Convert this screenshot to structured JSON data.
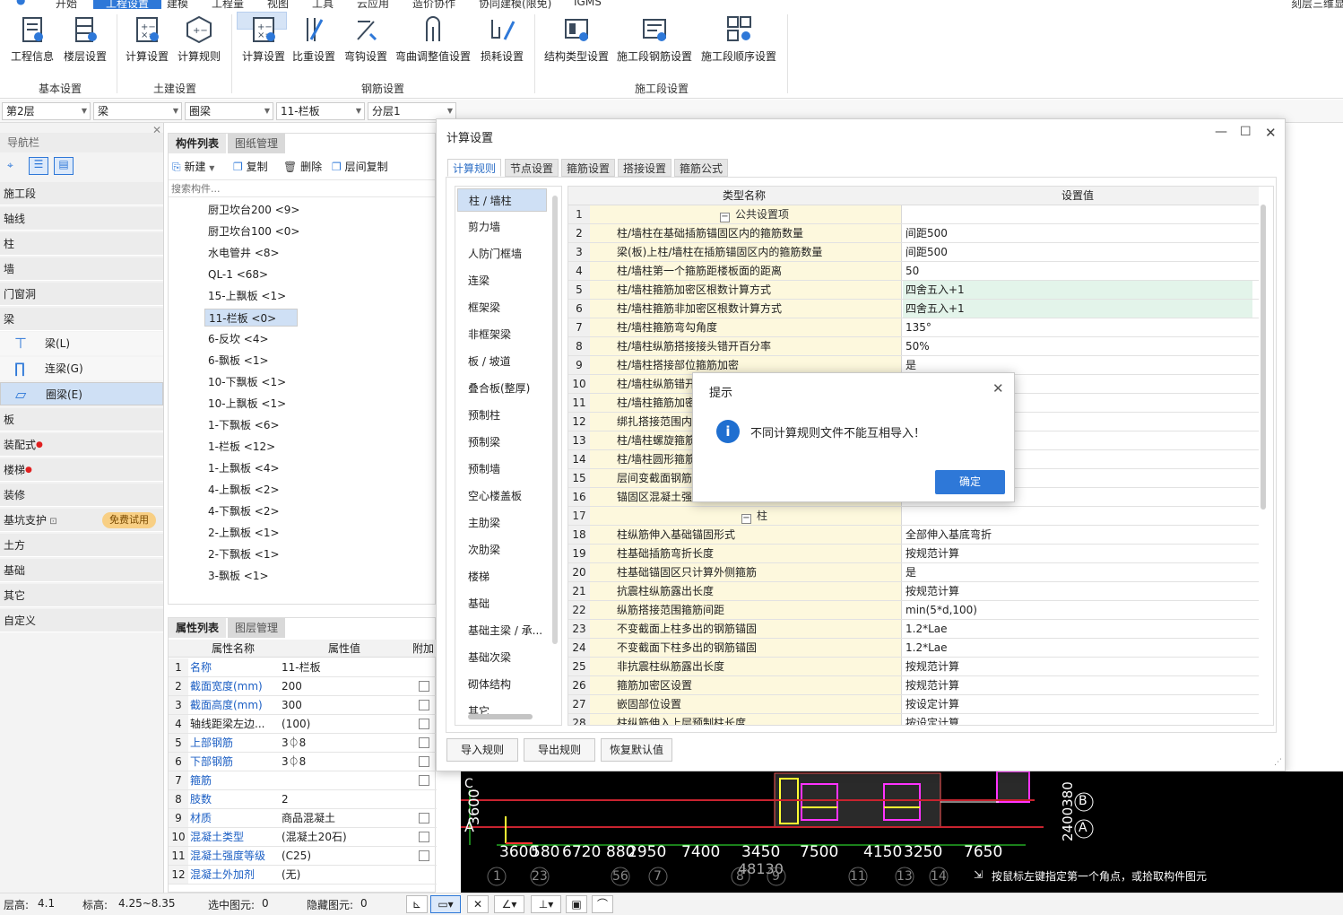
{
  "menu": {
    "items": [
      "开始",
      "工程设置",
      "建模",
      "工程量",
      "视图",
      "工具",
      "云应用",
      "造价协作",
      "协同建模(限免)",
      "IGMS"
    ],
    "active": "工程设置",
    "right_text": "刻层三维显"
  },
  "ribbon": {
    "buttons": [
      "工程信息",
      "楼层设置",
      "计算设置",
      "计算规则",
      "计算设置",
      "比重设置",
      "弯钩设置",
      "弯曲调整值设置",
      "损耗设置",
      "结构类型设置",
      "施工段钢筋设置",
      "施工段顺序设置"
    ],
    "groups": [
      "基本设置",
      "土建设置",
      "钢筋设置",
      "施工段设置"
    ]
  },
  "selectors": [
    "第2层",
    "梁",
    "圈梁",
    "11-栏板",
    "分层1"
  ],
  "nav": {
    "title": "导航栏",
    "items": [
      "施工段",
      "轴线",
      "柱",
      "墙",
      "门窗洞",
      "梁",
      "板",
      "装配式",
      "楼梯",
      "装修",
      "基坑支护",
      "土方",
      "基础",
      "其它",
      "自定义"
    ],
    "sub_items": [
      "梁(L)",
      "连梁(G)",
      "圈梁(E)"
    ],
    "trial_badge": "免费试用"
  },
  "components": {
    "tabs": [
      "构件列表",
      "图纸管理"
    ],
    "toolbar": [
      "新建",
      "复制",
      "删除",
      "层间复制"
    ],
    "search_placeholder": "搜索构件...",
    "items": [
      "厨卫坎台200 <9>",
      "厨卫坎台100 <0>",
      "水电管井 <8>",
      "QL-1 <68>",
      "15-上飘板 <1>",
      "11-栏板 <0>",
      "6-反坎 <4>",
      "6-飘板 <1>",
      "10-下飘板 <1>",
      "10-上飘板 <1>",
      "1-下飘板 <6>",
      "1-栏板 <12>",
      "1-上飘板 <4>",
      "4-上飘板 <2>",
      "4-下飘板 <2>",
      "2-上飘板 <1>",
      "2-下飘板 <1>",
      "3-飘板 <1>"
    ],
    "selected": "11-栏板 <0>"
  },
  "properties": {
    "tabs": [
      "属性列表",
      "图层管理"
    ],
    "headers": [
      "属性名称",
      "属性值",
      "附加"
    ],
    "rows": [
      {
        "no": "1",
        "name": "名称",
        "value": "11-栏板"
      },
      {
        "no": "2",
        "name": "截面宽度(mm)",
        "value": "200"
      },
      {
        "no": "3",
        "name": "截面高度(mm)",
        "value": "300"
      },
      {
        "no": "4",
        "name": "轴线距梁左边...",
        "value": "(100)"
      },
      {
        "no": "5",
        "name": "上部钢筋",
        "value": "3⏀8"
      },
      {
        "no": "6",
        "name": "下部钢筋",
        "value": "3⏀8"
      },
      {
        "no": "7",
        "name": "箍筋",
        "value": ""
      },
      {
        "no": "8",
        "name": "肢数",
        "value": "2"
      },
      {
        "no": "9",
        "name": "材质",
        "value": "商品混凝土"
      },
      {
        "no": "10",
        "name": "混凝土类型",
        "value": "(混凝土20石)"
      },
      {
        "no": "11",
        "name": "混凝土强度等级",
        "value": "(C25)"
      },
      {
        "no": "12",
        "name": "混凝土外加剂",
        "value": "(无)"
      }
    ]
  },
  "dialog": {
    "title": "计算设置",
    "tabs": [
      "计算规则",
      "节点设置",
      "箍筋设置",
      "搭接设置",
      "箍筋公式"
    ],
    "categories": [
      "柱 / 墙柱",
      "剪力墙",
      "人防门框墙",
      "连梁",
      "框架梁",
      "非框架梁",
      "板 / 坡道",
      "叠合板(整厚)",
      "预制柱",
      "预制梁",
      "预制墙",
      "空心楼盖板",
      "主肋梁",
      "次肋梁",
      "楼梯",
      "基础",
      "基础主梁 / 承...",
      "基础次梁",
      "砌体结构",
      "其它"
    ],
    "headers": [
      "类型名称",
      "设置值"
    ],
    "rows": [
      {
        "no": "1",
        "name": "公共设置项",
        "value": "",
        "group": true
      },
      {
        "no": "2",
        "name": "柱/墙柱在基础插筋锚固区内的箍筋数量",
        "value": "间距500"
      },
      {
        "no": "3",
        "name": "梁(板)上柱/墙柱在插筋锚固区内的箍筋数量",
        "value": "间距500"
      },
      {
        "no": "4",
        "name": "柱/墙柱第一个箍筋距楼板面的距离",
        "value": "50"
      },
      {
        "no": "5",
        "name": "柱/墙柱箍筋加密区根数计算方式",
        "value": "四舍五入+1",
        "hl": true
      },
      {
        "no": "6",
        "name": "柱/墙柱箍筋非加密区根数计算方式",
        "value": "四舍五入+1",
        "hl": true
      },
      {
        "no": "7",
        "name": "柱/墙柱箍筋弯勾角度",
        "value": "135°"
      },
      {
        "no": "8",
        "name": "柱/墙柱纵筋搭接接头错开百分率",
        "value": "50%"
      },
      {
        "no": "9",
        "name": "柱/墙柱搭接部位箍筋加密",
        "value": "是"
      },
      {
        "no": "10",
        "name": "柱/墙柱纵筋错开",
        "value": ""
      },
      {
        "no": "11",
        "name": "柱/墙柱箍筋加密",
        "value": ""
      },
      {
        "no": "12",
        "name": "绑扎搭接范围内",
        "value": ""
      },
      {
        "no": "13",
        "name": "柱/墙柱螺旋箍筋",
        "value": ""
      },
      {
        "no": "14",
        "name": "柱/墙柱圆形箍筋",
        "value": ""
      },
      {
        "no": "15",
        "name": "层间变截面钢筋",
        "value": ""
      },
      {
        "no": "16",
        "name": "锚固区混凝土强",
        "value": ""
      },
      {
        "no": "17",
        "name": "柱",
        "value": "",
        "group": true
      },
      {
        "no": "18",
        "name": "柱纵筋伸入基础锚固形式",
        "value": "全部伸入基底弯折"
      },
      {
        "no": "19",
        "name": "柱基础插筋弯折长度",
        "value": "按规范计算"
      },
      {
        "no": "20",
        "name": "柱基础锚固区只计算外侧箍筋",
        "value": "是"
      },
      {
        "no": "21",
        "name": "抗震柱纵筋露出长度",
        "value": "按规范计算"
      },
      {
        "no": "22",
        "name": "纵筋搭接范围箍筋间距",
        "value": "min(5*d,100)"
      },
      {
        "no": "23",
        "name": "不变截面上柱多出的钢筋锚固",
        "value": "1.2*Lae"
      },
      {
        "no": "24",
        "name": "不变截面下柱多出的钢筋锚固",
        "value": "1.2*Lae"
      },
      {
        "no": "25",
        "name": "非抗震柱纵筋露出长度",
        "value": "按规范计算"
      },
      {
        "no": "26",
        "name": "箍筋加密区设置",
        "value": "按规范计算"
      },
      {
        "no": "27",
        "name": "嵌固部位设置",
        "value": "按设定计算"
      },
      {
        "no": "28",
        "name": "柱纵筋伸入上层预制柱长度",
        "value": "按设定计算"
      }
    ],
    "buttons": [
      "导入规则",
      "导出规则",
      "恢复默认值"
    ]
  },
  "tip": {
    "title": "提示",
    "message": "不同计算规则文件不能互相导入！",
    "ok": "确定"
  },
  "cad": {
    "dims": [
      "3600",
      "580",
      "6720",
      "880",
      "2950",
      "7400",
      "3450",
      "7500",
      "4150",
      "3250",
      "7650"
    ],
    "total": "48130",
    "axis_nums": [
      "1",
      "23",
      "56",
      "7",
      "8",
      "9",
      "11",
      "13",
      "14"
    ],
    "axis_letters": [
      "C",
      "A",
      "B",
      "A"
    ],
    "left_dim": "3600",
    "right_dim": "2400380",
    "hint": "按鼠标左键指定第一个角点，或拾取构件图元"
  },
  "status": {
    "floor_height_label": "层高:",
    "floor_height": "4.1",
    "elev_label": "标高:",
    "elev": "4.25~8.35",
    "selected_label": "选中图元:",
    "selected": "0",
    "hidden_label": "隐藏图元:",
    "hidden": "0"
  }
}
